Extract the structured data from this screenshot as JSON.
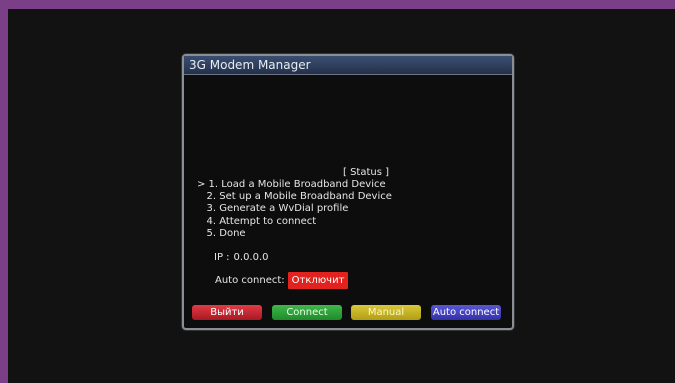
{
  "window": {
    "title": "3G Modem Manager",
    "status_label": "[ Status ]",
    "menu": [
      "> 1. Load a Mobile Broadband Device",
      "   2. Set up a Mobile Broadband Device",
      "   3. Generate a WvDial profile",
      "   4. Attempt to connect",
      "   5. Done"
    ],
    "ip_label": "IP :",
    "ip_value": "0.0.0.0",
    "auto_connect_label": "Auto connect:",
    "auto_connect_value": "Отключит"
  },
  "buttons": {
    "red": "Выйти",
    "green": "Connect",
    "yellow": "Manual",
    "blue": "Auto connect"
  },
  "colors": {
    "red": "#e23b45",
    "green": "#3fb84a",
    "yellow": "#d9c83a",
    "blue": "#5a57d6",
    "badge": "#e2221e"
  }
}
